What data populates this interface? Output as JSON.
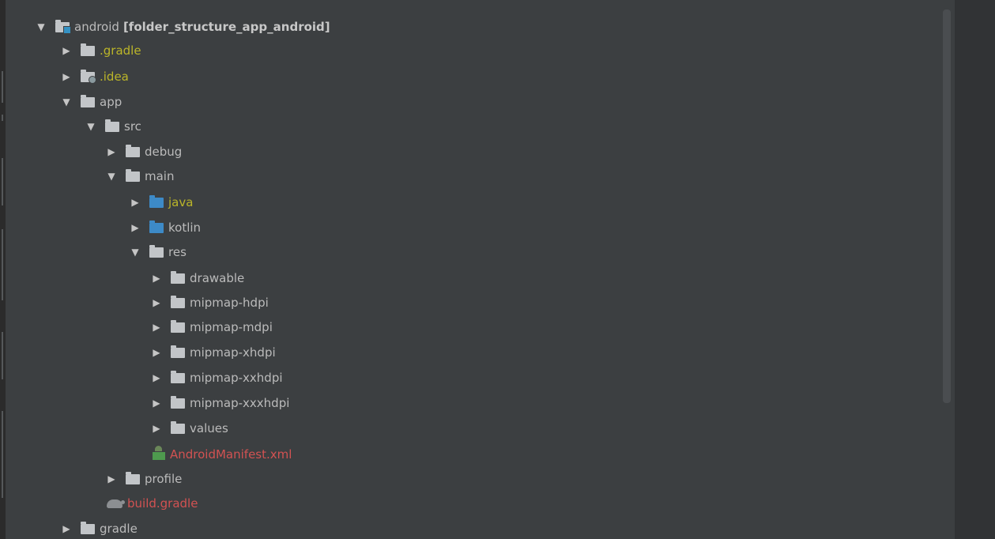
{
  "tree": {
    "root": {
      "name": "android",
      "module": "[folder_structure_app_android]"
    },
    "gradle_dot": ".gradle",
    "idea": ".idea",
    "app": "app",
    "src": "src",
    "debug": "debug",
    "main": "main",
    "java": "java",
    "kotlin": "kotlin",
    "res": "res",
    "drawable": "drawable",
    "mipmap_hdpi": "mipmap-hdpi",
    "mipmap_mdpi": "mipmap-mdpi",
    "mipmap_xhdpi": "mipmap-xhdpi",
    "mipmap_xxhdpi": "mipmap-xxhdpi",
    "mipmap_xxxhdpi": "mipmap-xxxhdpi",
    "values": "values",
    "manifest": "AndroidManifest.xml",
    "profile": "profile",
    "build_gradle": "build.gradle",
    "gradle": "gradle"
  },
  "icons": {
    "expanded": "triangle-down-icon",
    "collapsed": "triangle-right-icon",
    "folder": "folder-icon",
    "source_folder": "source-folder-icon",
    "module": "module-folder-icon",
    "manifest": "android-manifest-icon",
    "gradle": "gradle-elephant-icon"
  },
  "colors": {
    "background": "#3c3f41",
    "text": "#bbbbbb",
    "excluded": "#bbb529",
    "unversioned": "#d25252",
    "source_folder": "#3d8ac7"
  }
}
